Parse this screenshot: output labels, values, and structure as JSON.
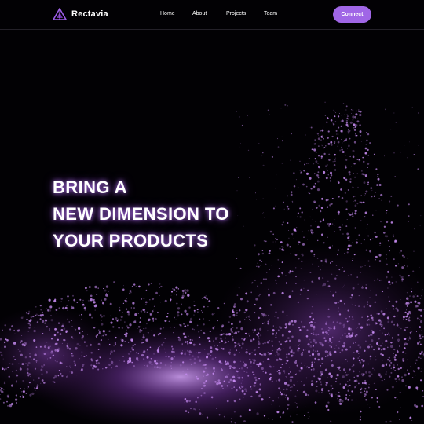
{
  "brand": {
    "name": "Rectavia",
    "icon": "triangle-logo-icon"
  },
  "nav": {
    "items": [
      "Home",
      "About",
      "Projects",
      "Team"
    ]
  },
  "header": {
    "connect_label": "Connect"
  },
  "hero": {
    "lines": [
      "BRING A",
      "NEW DIMENSION TO",
      "YOUR PRODUCTS"
    ]
  },
  "colors": {
    "accent": "#a066e6",
    "background": "#020104",
    "particle": "#c78cf2",
    "glow": "#be78ff"
  }
}
